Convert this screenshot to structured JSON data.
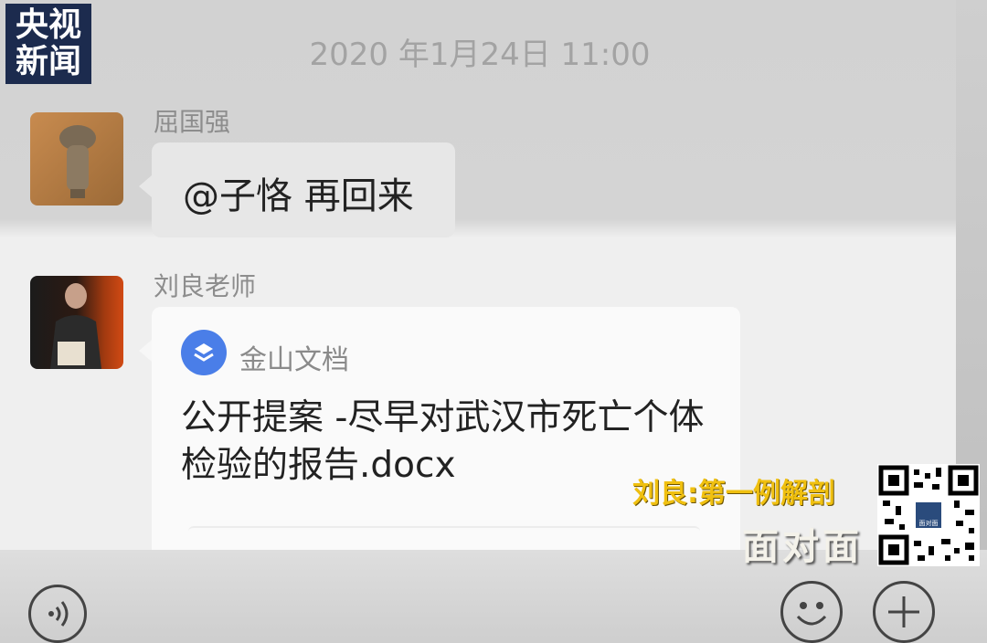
{
  "broadcaster_logo": {
    "line1": "央视",
    "line2": "新闻"
  },
  "chat": {
    "timestamp": "2020 年1月24日 11:00",
    "messages": [
      {
        "sender": "屈国强",
        "text": "@子恪 再回来"
      },
      {
        "sender": "刘良老师",
        "file_card": {
          "app_name": "金山文档",
          "file_title": "公开提案 -尽早对武汉市死亡个体检验的报告.docx"
        }
      }
    ]
  },
  "input_bar": {
    "voice_icon": "voice-icon",
    "emoji_icon": "emoji-icon",
    "plus_icon": "plus-icon"
  },
  "overlay": {
    "caption_top": "刘良:第一例解剖",
    "caption_bottom": "面对面",
    "qr_label": "面对面"
  },
  "colors": {
    "caption_accent": "#f0c010",
    "doc_icon": "#4a7ee8",
    "logo_bg": "#1c2b4e"
  }
}
